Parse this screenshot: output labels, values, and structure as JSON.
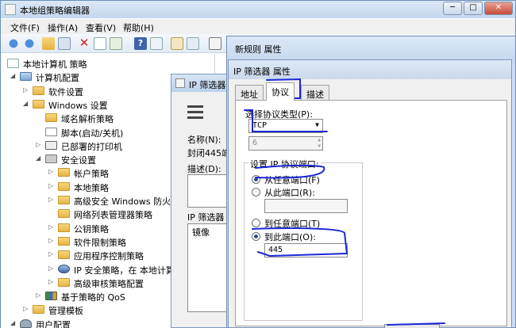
{
  "main_window": {
    "title": "本地组策略编辑器"
  },
  "menu": [
    "文件(F)",
    "操作(A)",
    "查看(V)",
    "帮助(H)"
  ],
  "tree": [
    {
      "label": "本地计算机 策略",
      "indent": 0,
      "icon": "computer-policy-icon",
      "exp": ""
    },
    {
      "label": "计算机配置",
      "indent": 1,
      "icon": "computer-icon",
      "exp": "▲"
    },
    {
      "label": "软件设置",
      "indent": 2,
      "icon": "folder-icon",
      "exp": "▷"
    },
    {
      "label": "Windows 设置",
      "indent": 2,
      "icon": "folder-icon",
      "exp": "▲"
    },
    {
      "label": "域名解析策略",
      "indent": 3,
      "icon": "folder-icon",
      "exp": ""
    },
    {
      "label": "脚本(启动/关机)",
      "indent": 3,
      "icon": "script-icon",
      "exp": ""
    },
    {
      "label": "已部署的打印机",
      "indent": 3,
      "icon": "printer-icon",
      "exp": "▷"
    },
    {
      "label": "安全设置",
      "indent": 3,
      "icon": "shield-icon",
      "exp": "▲"
    },
    {
      "label": "帐户策略",
      "indent": 4,
      "icon": "folder-icon",
      "exp": "▷"
    },
    {
      "label": "本地策略",
      "indent": 4,
      "icon": "folder-icon",
      "exp": "▷"
    },
    {
      "label": "高级安全 Windows 防火墙",
      "indent": 4,
      "icon": "folder-icon",
      "exp": "▷"
    },
    {
      "label": "网络列表管理器策略",
      "indent": 4,
      "icon": "folder-icon",
      "exp": ""
    },
    {
      "label": "公钥策略",
      "indent": 4,
      "icon": "folder-icon",
      "exp": "▷"
    },
    {
      "label": "软件限制策略",
      "indent": 4,
      "icon": "folder-icon",
      "exp": "▷"
    },
    {
      "label": "应用程序控制策略",
      "indent": 4,
      "icon": "folder-icon",
      "exp": "▷"
    },
    {
      "label": "IP 安全策略，在 本地计算机",
      "indent": 4,
      "icon": "ipsec-icon",
      "exp": "▷"
    },
    {
      "label": "高级审核策略配置",
      "indent": 4,
      "icon": "folder-icon",
      "exp": "▷"
    },
    {
      "label": "基于策略的 QoS",
      "indent": 3,
      "icon": "chart-icon",
      "exp": "▷"
    },
    {
      "label": "管理模板",
      "indent": 2,
      "icon": "folder-icon",
      "exp": "▷"
    },
    {
      "label": "用户配置",
      "indent": 1,
      "icon": "user-icon",
      "exp": "▲"
    }
  ],
  "ip_filter_list_dialog": {
    "title": "IP 筛选器",
    "name_label": "名称(N):",
    "name_value": "封闭445端",
    "desc_label": "描述(D):",
    "list_label": "IP 筛选器",
    "column": "镜像"
  },
  "new_rule_dialog": {
    "title": "新规则 属性"
  },
  "filter_props_dialog": {
    "title": "IP 筛选器 属性",
    "tabs": [
      "地址",
      "协议",
      "描述"
    ],
    "protocol_type_label": "选择协议类型(P):",
    "protocol_type_value": "TCP",
    "protocol_number": "6",
    "port_group_label": "设置 IP 协议端口:",
    "from_any_port": "从任意端口(F)",
    "from_this_port": "从此端口(R):",
    "to_any_port": "到任意端口(T)",
    "to_this_port": "到此端口(O):",
    "to_port_value": "445"
  }
}
